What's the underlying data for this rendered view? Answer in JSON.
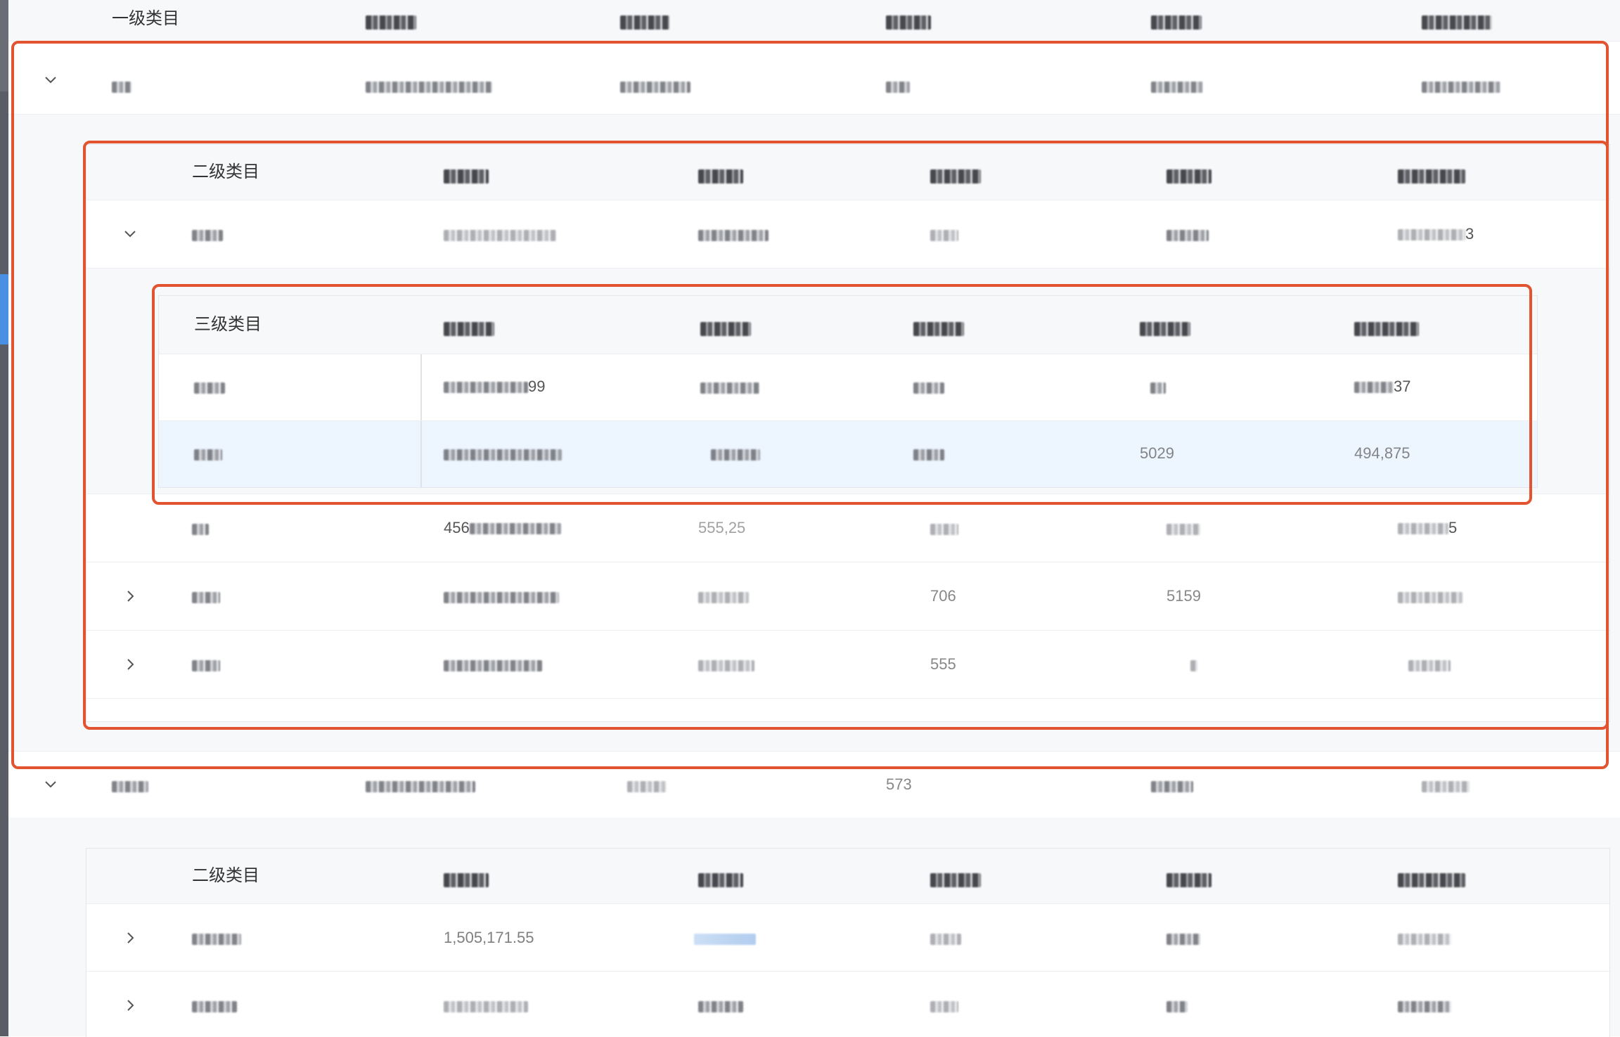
{
  "level1": {
    "header": "一级类目",
    "rows": [
      {
        "expanded": true
      },
      {
        "expanded": true,
        "partial": {
          "c3": "573"
        }
      }
    ]
  },
  "level2_block1": {
    "header": "二级类目",
    "rows": [
      {
        "expanded": true,
        "partial": {
          "c5": "3"
        }
      },
      {
        "partial": {
          "c1": "456",
          "c2": "555,25",
          "c5": "5"
        }
      },
      {
        "partial": {
          "c3": "706",
          "c4": "5159"
        }
      },
      {
        "partial": {
          "c3": "555"
        }
      }
    ]
  },
  "level3": {
    "header": "三级类目",
    "rows": [
      {
        "partial": {
          "c1": "99",
          "c5": "37"
        }
      },
      {
        "partial": {
          "c4": "5029",
          "c5": "494,875"
        },
        "selected": true
      }
    ]
  },
  "level2_block2": {
    "header": "二级类目",
    "rows": [
      {
        "partial": {
          "c1": "1,505,171.55"
        }
      },
      {}
    ]
  },
  "colors": {
    "highlight_box": "#e2542f",
    "header_bg": "#f7f8fa",
    "selected_row_bg": "#edf5ff",
    "sidebar_accent": "#4a90e2"
  }
}
